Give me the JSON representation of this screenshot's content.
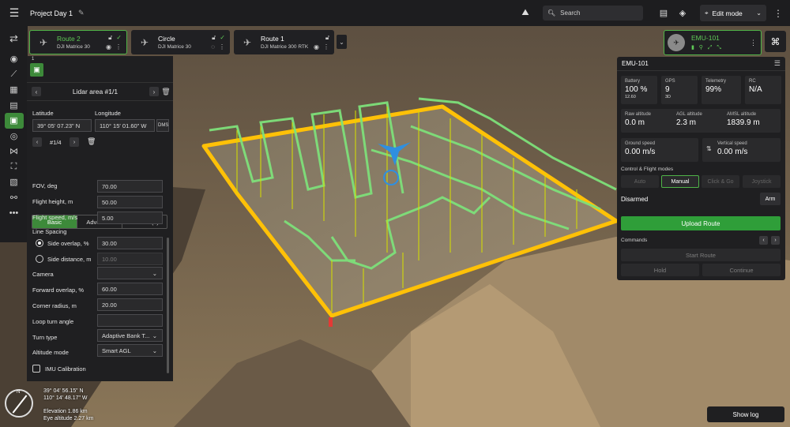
{
  "project": {
    "title": "Project Day 1"
  },
  "topbar": {
    "search_placeholder": "Search",
    "edit_mode_label": "Edit mode"
  },
  "routes": [
    {
      "name": "Route 2",
      "model": "DJI Matrice 30",
      "selected": true
    },
    {
      "name": "Circle",
      "model": "DJI Matrice 30",
      "selected": false
    },
    {
      "name": "Route 1",
      "model": "DJI Matrice 300 RTK",
      "selected": false
    }
  ],
  "lidar_panel": {
    "tab_number": "1",
    "area_name": "Lidar area #1/1",
    "latitude_label": "Latitude",
    "longitude_label": "Longitude",
    "latitude": "39° 05' 07.23\" N",
    "longitude": "110° 15' 01.60\" W",
    "format_button": "DMS",
    "point_counter": "#1/4",
    "tabs": [
      "Basic",
      "Advanced",
      "Actions (1)"
    ],
    "fov_label": "FOV, deg",
    "fov": "70.00",
    "flight_height_label": "Flight height, m",
    "flight_height": "50.00",
    "flight_speed_label": "Flight speed, m/s",
    "flight_speed": "5.00",
    "line_spacing_label": "Line Spacing",
    "side_overlap_label": "Side overlap, %",
    "side_overlap": "30.00",
    "side_distance_label": "Side distance, m",
    "side_distance": "10.00",
    "camera_label": "Camera",
    "camera": "",
    "forward_overlap_label": "Forward overlap, %",
    "forward_overlap": "60.00",
    "corner_radius_label": "Corner radius, m",
    "corner_radius": "20.00",
    "loop_turn_angle_label": "Loop turn angle",
    "loop_turn_angle": "",
    "turn_type_label": "Turn type",
    "turn_type": "Adaptive Bank T...",
    "altitude_mode_label": "Altitude mode",
    "altitude_mode": "Smart AGL",
    "imu_label": "IMU Calibration"
  },
  "map_info": {
    "compass_letter": "N",
    "lat": "39° 04' 56.15\" N",
    "lon": "110° 14' 48.17\" W",
    "elevation": "Elevation 1.86 km",
    "eye_altitude": "Eye altitude 2.27 km"
  },
  "drone_card": {
    "name": "EMU-101"
  },
  "telemetry": {
    "title": "EMU-101",
    "battery_label": "Battery",
    "battery": "100 %",
    "battery_voltage": "12.60",
    "gps_label": "GPS",
    "gps": "9",
    "gps_fix": "3D",
    "telemetry_label": "Telemetry",
    "telemetry": "99%",
    "rc_label": "RC",
    "rc": "N/A",
    "raw_alt_label": "Raw altitude",
    "raw_alt": "0.0 m",
    "agl_label": "AGL altitude",
    "agl": "2.3 m",
    "amsl_label": "AMSL altitude",
    "amsl": "1839.9 m",
    "ground_speed_label": "Ground speed",
    "ground_speed": "0.00 m/s",
    "vertical_speed_label": "Vertical speed",
    "vertical_speed": "0.00 m/s",
    "modes_label": "Control & Flight modes",
    "modes": [
      "Auto",
      "Manual",
      "Click & Go",
      "Joystick"
    ],
    "active_mode": "Manual",
    "arm_status": "Disarmed",
    "arm_button": "Arm",
    "upload_button": "Upload Route",
    "commands_label": "Commands",
    "start_route": "Start Route",
    "hold": "Hold",
    "continue": "Continue"
  },
  "show_log_button": "Show log",
  "colors": {
    "accent_green": "#3d8a3a",
    "route_yellow": "#ffc107",
    "route_green": "#7ee07a",
    "panel_bg": "#1f1f21"
  }
}
